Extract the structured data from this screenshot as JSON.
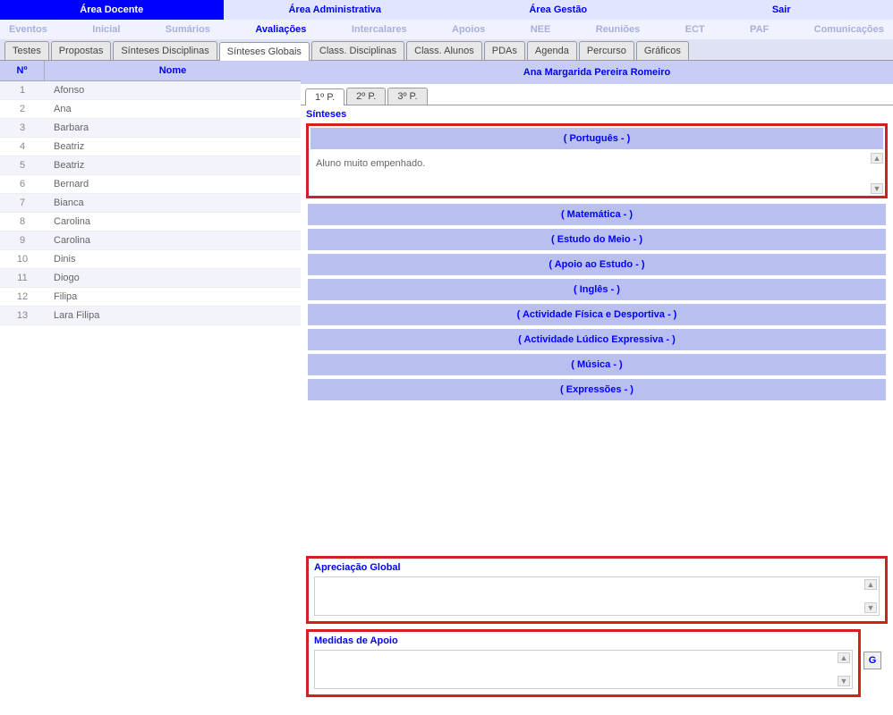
{
  "areas": [
    "Área Docente",
    "Área Administrativa",
    "Área Gestão",
    "Sair"
  ],
  "area_active": 0,
  "subnav": [
    "Eventos",
    "Inicial",
    "Sumários",
    "Avaliações",
    "Intercalares",
    "Apoios",
    "NEE",
    "Reuniões",
    "ECT",
    "PAF",
    "Comunicações"
  ],
  "subnav_active": 3,
  "tabs": [
    "Testes",
    "Propostas",
    "Sínteses Disciplinas",
    "Sínteses Globais",
    "Class. Disciplinas",
    "Class. Alunos",
    "PDAs",
    "Agenda",
    "Percurso",
    "Gráficos"
  ],
  "tabs_active": 3,
  "student_head": {
    "num": "Nº",
    "name": "Nome"
  },
  "students": [
    {
      "num": "1",
      "name": "Afonso"
    },
    {
      "num": "2",
      "name": "Ana"
    },
    {
      "num": "3",
      "name": "Barbara"
    },
    {
      "num": "4",
      "name": "Beatriz"
    },
    {
      "num": "5",
      "name": "Beatriz"
    },
    {
      "num": "6",
      "name": "Bernard"
    },
    {
      "num": "7",
      "name": "Bianca"
    },
    {
      "num": "8",
      "name": "Carolina"
    },
    {
      "num": "9",
      "name": "Carolina"
    },
    {
      "num": "10",
      "name": "Dinis"
    },
    {
      "num": "11",
      "name": "Diogo"
    },
    {
      "num": "12",
      "name": "Filipa"
    },
    {
      "num": "13",
      "name": "Lara Filipa"
    }
  ],
  "selected_student": "Ana Margarida Pereira Romeiro",
  "periods": [
    "1º P.",
    "2º P.",
    "3º P."
  ],
  "period_active": 0,
  "labels": {
    "sinteses": "Sínteses",
    "apreciacao": "Apreciação Global",
    "medidas": "Medidas de Apoio",
    "g_button": "G"
  },
  "expanded_subject": {
    "title": "( Português -  )",
    "content": "Aluno muito empenhado."
  },
  "subjects": [
    "( Matemática -  )",
    "( Estudo do Meio -  )",
    "( Apoio ao Estudo -  )",
    "( Inglês -  )",
    "( Actividade Física e Desportiva -  )",
    "( Actividade Lúdico Expressiva -  )",
    "( Música -  )",
    "( Expressões -  )"
  ]
}
